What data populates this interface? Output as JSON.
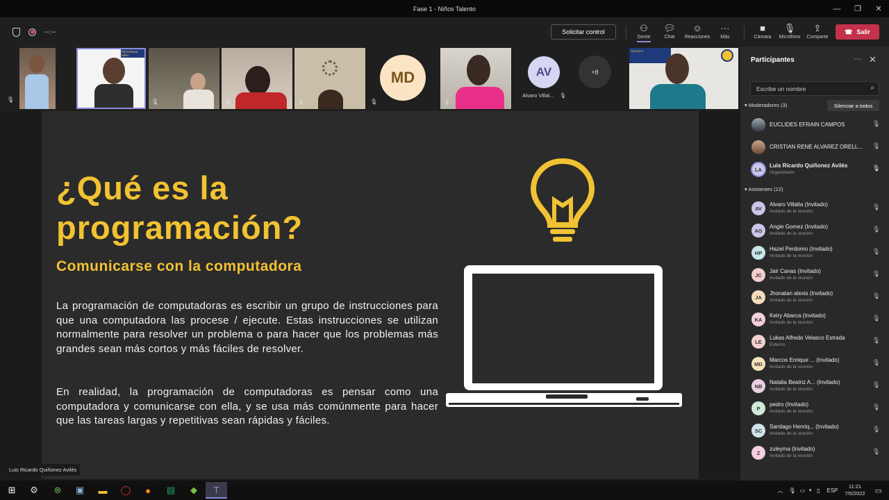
{
  "window": {
    "title": "Fase 1 - Niños Talento",
    "min": "—",
    "restore": "❐",
    "close": "✕"
  },
  "toolbar": {
    "timer": "--:--",
    "request_control": "Solicitar control",
    "people": "Gente",
    "chat": "Chat",
    "reactions": "Reacciones",
    "more": "Más",
    "camera": "Cámara",
    "mic": "Micrófono",
    "share": "Comparte",
    "leave": "Salir",
    "leave_color": "#c4314b"
  },
  "video_strip": {
    "tiles": [
      {
        "initials": "",
        "name": ""
      },
      {
        "initials": "",
        "name": ""
      },
      {
        "initials": "",
        "name": ""
      },
      {
        "initials": "",
        "name": ""
      },
      {
        "initials": "",
        "name": ""
      },
      {
        "initials": "MD",
        "name": ""
      },
      {
        "initials": "",
        "name": ""
      },
      {
        "initials": "AV",
        "name": "Alvaro Villal..."
      },
      {
        "initials": "+8",
        "name": ""
      }
    ],
    "banner_text_1": "PROGRAMA NIÑO",
    "banner_text_2": "TALENTO"
  },
  "slide": {
    "title_line1": "¿Qué es la",
    "title_line2": "programación?",
    "subtitle": "Comunicarse con la computadora",
    "paragraph1": "La programación de computadoras es escribir un grupo de instrucciones para que una computadora las procese / ejecute. Estas instrucciones se utilizan normalmente para resolver un problema o para hacer que los problemas más grandes sean más cortos y más fáciles de resolver.",
    "paragraph2": "En realidad, la programación de computadoras es pensar como una computadora y comunicarse con ella, y se usa más comúnmente para hacer que las tareas largas y repetitivas sean rápidas y fáciles.",
    "accent_color": "#f1c232"
  },
  "presenter_name": "Luis Ricardo Quiñonez Avilés",
  "participants": {
    "title": "Participantes",
    "search_placeholder": "Escribe un nombre",
    "moderators_header": "Moderadores (3)",
    "mute_all": "Silenciar a todos",
    "moderators": [
      {
        "initials": "",
        "name": "EUCLIDES EFRAIN CAMPOS",
        "role": ""
      },
      {
        "initials": "",
        "name": "CRISTIAN RENE ALVAREZ ORELL...",
        "role": ""
      },
      {
        "initials": "LA",
        "name": "Luis Ricardo Quiñonez Avilés",
        "role": "Organizador"
      }
    ],
    "attendees_header": "Asistentes (12)",
    "attendees": [
      {
        "initials": "AV",
        "name": "Alvaro Villalta (Invitado)",
        "role": "Invitado de la reunión",
        "color": "#c9c6ea"
      },
      {
        "initials": "AG",
        "name": "Angie Gomez (Invitado)",
        "role": "Invitado de la reunión",
        "color": "#c9c6ea"
      },
      {
        "initials": "HP",
        "name": "Hazel Perdomo (Invitado)",
        "role": "Invitado de la reunión",
        "color": "#c6e6ea"
      },
      {
        "initials": "JC",
        "name": "Jair Canas (Invitado)",
        "role": "Invitado de la reunión",
        "color": "#f3cfcf"
      },
      {
        "initials": "JA",
        "name": "Jhonatan alexis (Invitado)",
        "role": "Invitado de la reunión",
        "color": "#f6dcbd"
      },
      {
        "initials": "KA",
        "name": "Keiry Abarca (Invitado)",
        "role": "Invitado de la reunión",
        "color": "#f3cfdf"
      },
      {
        "initials": "LE",
        "name": "Lukas Alfredo Velasco Estrada",
        "role": "Externo",
        "color": "#f3cfcf"
      },
      {
        "initials": "MD",
        "name": "Marcos Enrique ...  (Invitado)",
        "role": "Invitado de la reunión",
        "color": "#f6e2bd"
      },
      {
        "initials": "NB",
        "name": "Natalia Beatriz A...  (Invitado)",
        "role": "Invitado de la reunión",
        "color": "#e8cfe0"
      },
      {
        "initials": "P",
        "name": "pedro (Invitado)",
        "role": "Invitado de la reunión",
        "color": "#cfe9d6"
      },
      {
        "initials": "SC",
        "name": "Santiago Henriq...  (Invitado)",
        "role": "Invitado de la reunión",
        "color": "#cfe3ea"
      },
      {
        "initials": "Z",
        "name": "zuleyma (Invitado)",
        "role": "Invitado de la reunión",
        "color": "#f3cfdf"
      }
    ]
  },
  "taskbar": {
    "lang": "ESP",
    "time": "11:21",
    "date": "7/5/2022"
  }
}
